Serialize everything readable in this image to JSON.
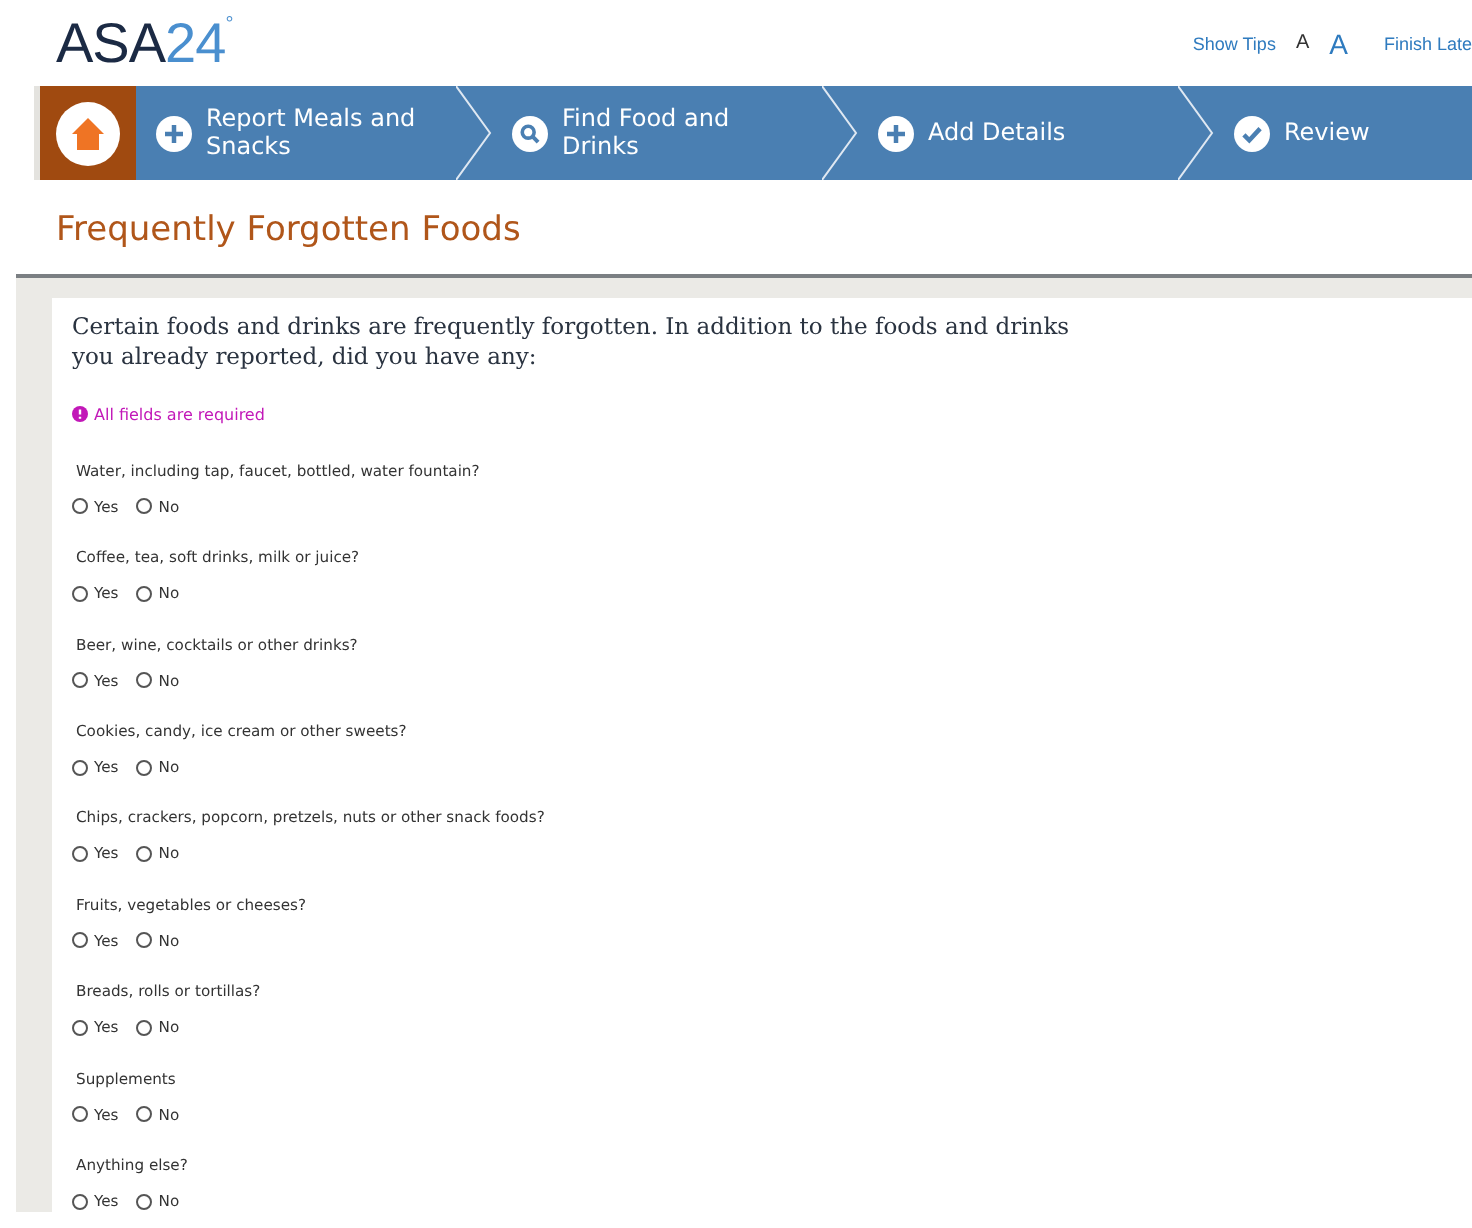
{
  "logo": {
    "name": "ASA",
    "number": "24",
    "mark": "°"
  },
  "header_links": [
    {
      "label": "Show Tips",
      "kind": "link"
    },
    {
      "label": "A",
      "kind": "small-font"
    },
    {
      "label": "A",
      "kind": "large-font"
    },
    {
      "label": "Finish Late",
      "kind": "link"
    }
  ],
  "steps": [
    {
      "label": "Report Meals and Snacks",
      "kind": "plus"
    },
    {
      "label": "Find Food and Drinks",
      "kind": "search"
    },
    {
      "label": "Add Details",
      "kind": "plus"
    },
    {
      "label": "Review",
      "kind": "check"
    }
  ],
  "page_title": "Frequently Forgotten Foods",
  "intro": "Certain foods and drinks are frequently forgotten. In addition to the foods and drinks you already reported, did you have any:",
  "required_note": "All fields are required",
  "questions": [
    {
      "text": "Water, including tap, faucet, bottled, water fountain?",
      "options": [
        {
          "label": "Yes",
          "selected": false
        },
        {
          "label": "No",
          "selected": false
        }
      ]
    },
    {
      "text": "Coffee, tea, soft drinks, milk or juice?",
      "options": [
        {
          "label": "Yes",
          "selected": false
        },
        {
          "label": "No",
          "selected": false
        }
      ]
    },
    {
      "text": "Beer, wine, cocktails or other drinks?",
      "options": [
        {
          "label": "Yes",
          "selected": false
        },
        {
          "label": "No",
          "selected": false
        }
      ]
    },
    {
      "text": "Cookies, candy, ice cream or other sweets?",
      "options": [
        {
          "label": "Yes",
          "selected": false
        },
        {
          "label": "No",
          "selected": false
        }
      ]
    },
    {
      "text": "Chips, crackers, popcorn, pretzels, nuts or other snack foods?",
      "options": [
        {
          "label": "Yes",
          "selected": false
        },
        {
          "label": "No",
          "selected": false
        }
      ]
    },
    {
      "text": "Fruits, vegetables or cheeses?",
      "options": [
        {
          "label": "Yes",
          "selected": false
        },
        {
          "label": "No",
          "selected": false
        }
      ]
    },
    {
      "text": "Breads, rolls or tortillas?",
      "options": [
        {
          "label": "Yes",
          "selected": false
        },
        {
          "label": "No",
          "selected": false
        }
      ]
    },
    {
      "text": "Supplements",
      "options": [
        {
          "label": "Yes",
          "selected": false
        },
        {
          "label": "No",
          "selected": false
        }
      ]
    },
    {
      "text": "Anything else?",
      "options": [
        {
          "label": "Yes",
          "selected": false
        },
        {
          "label": "No",
          "selected": false
        }
      ]
    }
  ]
}
